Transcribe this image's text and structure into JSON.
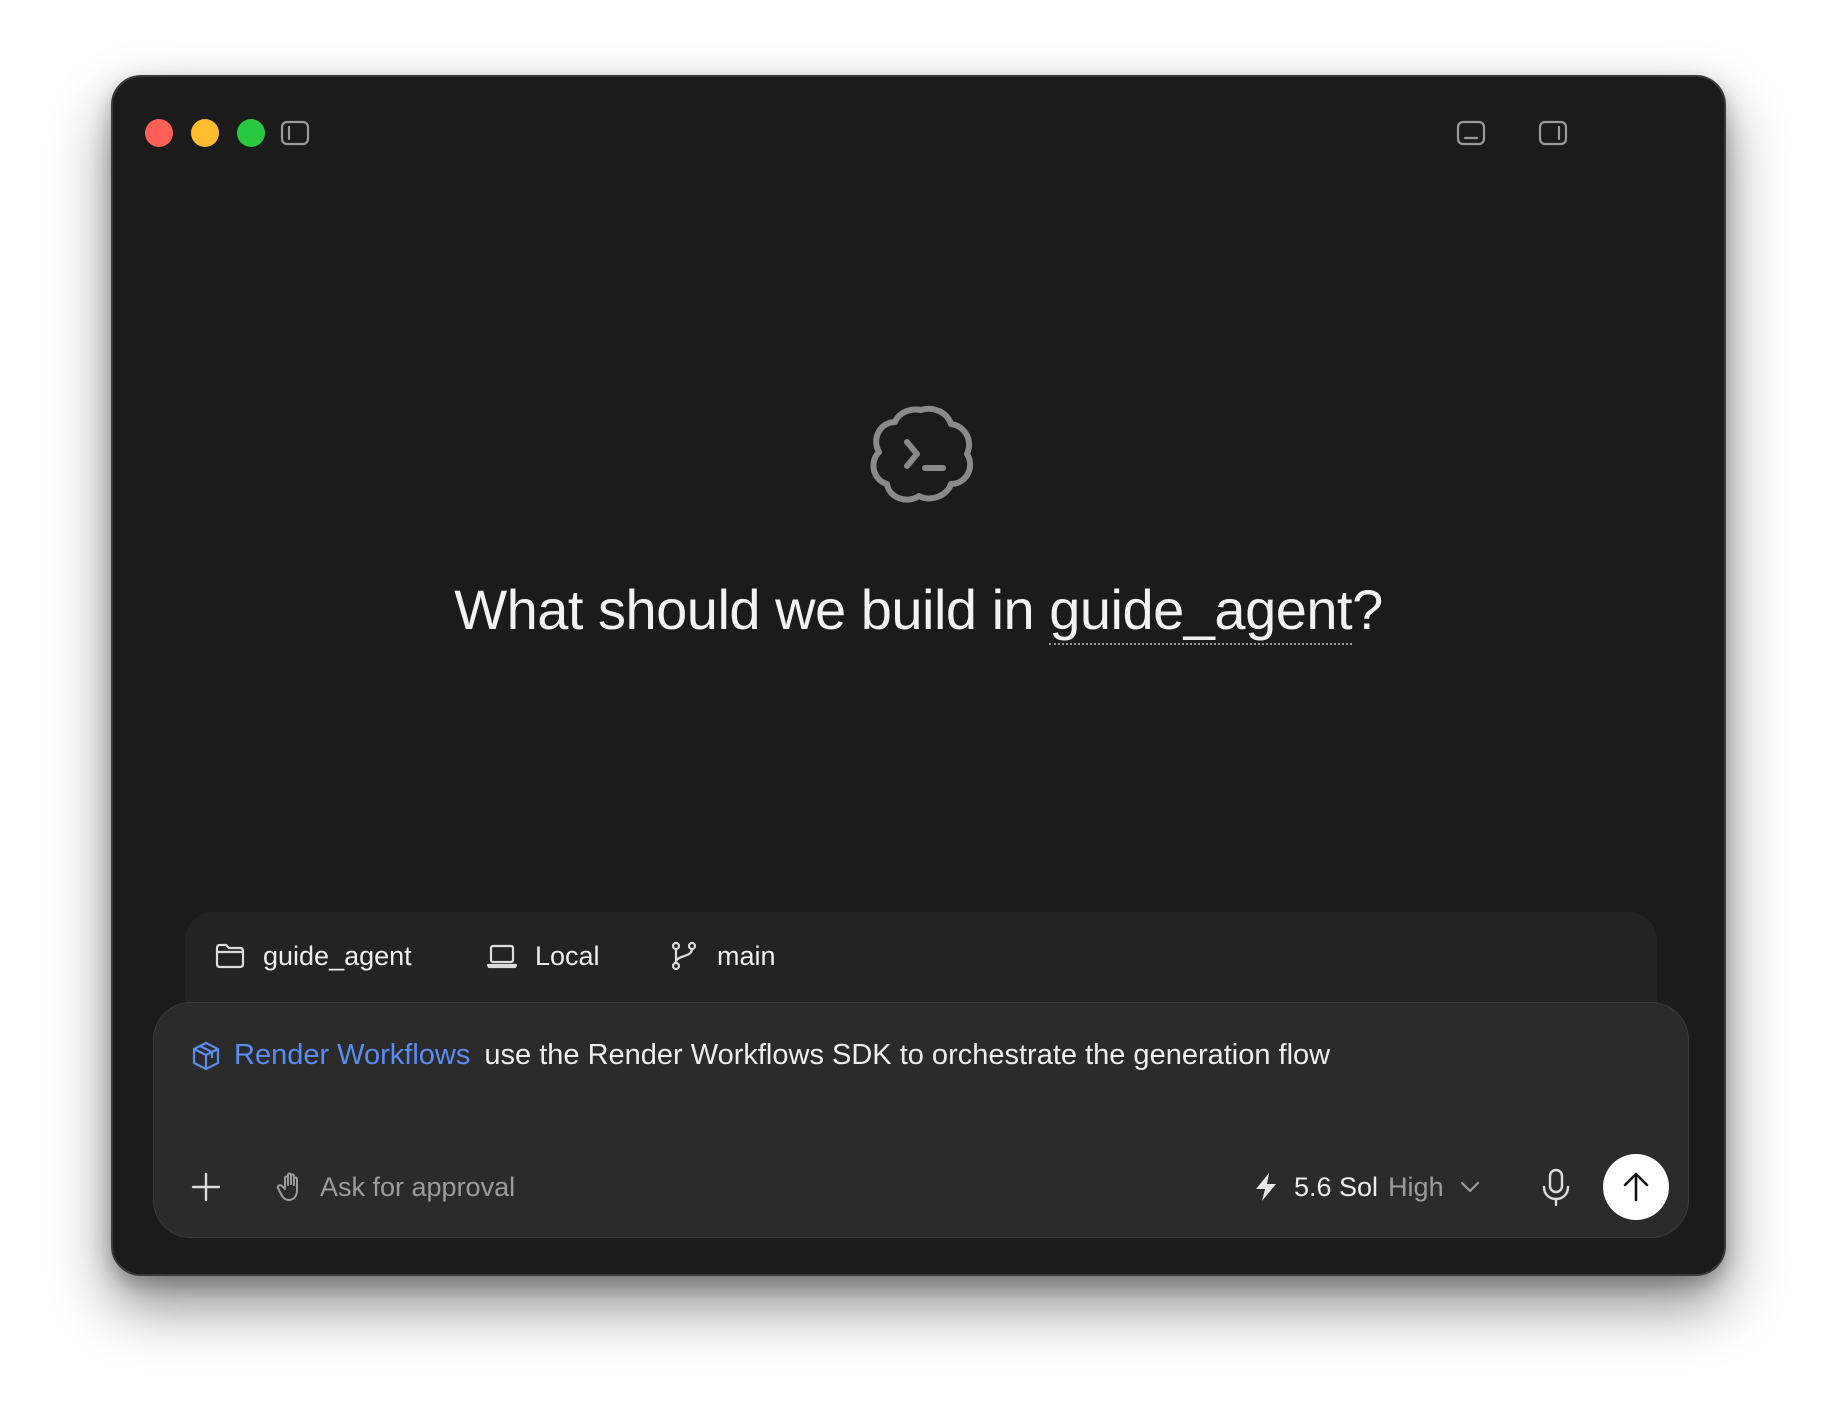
{
  "window": {
    "traffic_lights": [
      "close",
      "minimize",
      "zoom"
    ],
    "toolbar_icons": [
      "sidebar-left-icon",
      "panel-bottom-icon",
      "sidebar-right-icon"
    ]
  },
  "hero": {
    "logo_icon": "terminal-cloud-logo",
    "headline_prefix": "What should we build in ",
    "project_name": "guide_agent",
    "headline_suffix": "?"
  },
  "context": {
    "folder": {
      "icon": "folder-icon",
      "label": "guide_agent"
    },
    "environment": {
      "icon": "laptop-icon",
      "label": "Local"
    },
    "branch": {
      "icon": "git-branch-icon",
      "label": "main"
    }
  },
  "composer": {
    "skill": {
      "icon": "cube-icon",
      "name": "Render Workflows",
      "color": "#5b8cf0"
    },
    "prompt": "use the Render Workflows SDK to orchestrate the generation flow",
    "add_icon": "plus-icon",
    "approval": {
      "icon": "hand-icon",
      "label": "Ask for approval"
    },
    "model": {
      "icon": "bolt-icon",
      "name": "5.6 Sol",
      "level": "High",
      "chevron": "chevron-down-icon"
    },
    "mic_icon": "microphone-icon",
    "send_icon": "arrow-up-icon"
  },
  "colors": {
    "background": "#1b1b1b",
    "composer": "#2b2b2b",
    "accent": "#5b8cf0",
    "send_button": "#ffffff"
  }
}
